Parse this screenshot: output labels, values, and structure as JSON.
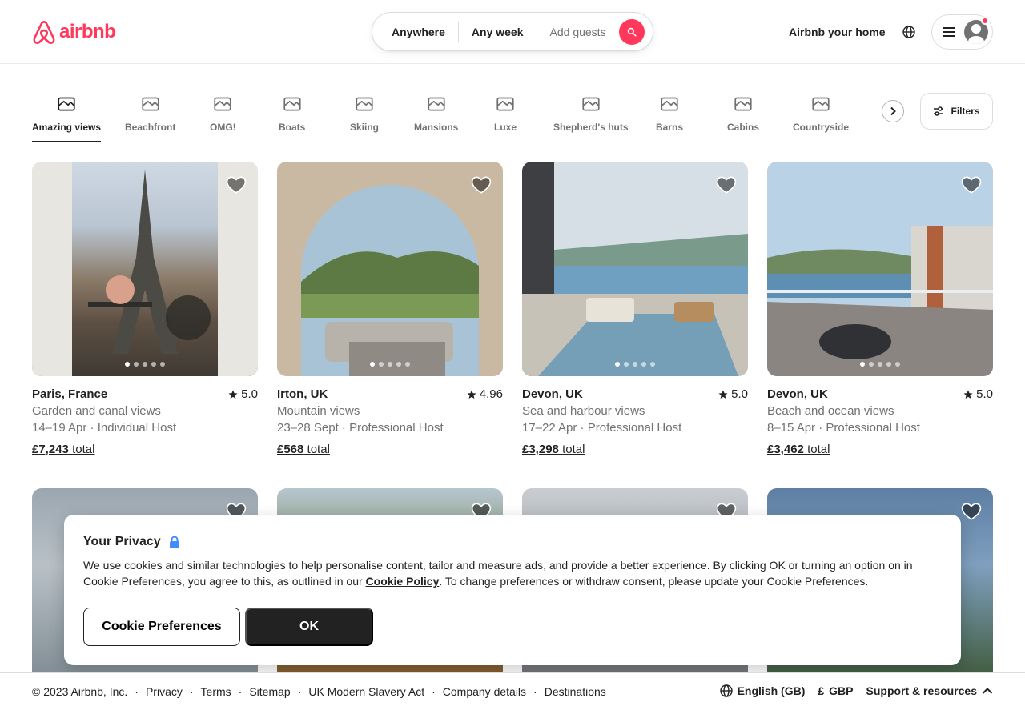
{
  "brand": {
    "name": "airbnb",
    "color": "#ff385c"
  },
  "search": {
    "where": "Anywhere",
    "when": "Any week",
    "who": "Add guests"
  },
  "header": {
    "host_link": "Airbnb your home"
  },
  "categories": [
    {
      "label": "Amazing views",
      "icon": "amazing-views-icon",
      "active": true
    },
    {
      "label": "Beachfront",
      "icon": "beachfront-icon"
    },
    {
      "label": "OMG!",
      "icon": "omg-icon"
    },
    {
      "label": "Boats",
      "icon": "boat-icon"
    },
    {
      "label": "Skiing",
      "icon": "skiing-icon"
    },
    {
      "label": "Mansions",
      "icon": "mansion-icon"
    },
    {
      "label": "Luxe",
      "icon": "luxe-icon"
    },
    {
      "label": "Shepherd's huts",
      "icon": "shepherds-hut-icon"
    },
    {
      "label": "Barns",
      "icon": "barn-icon"
    },
    {
      "label": "Cabins",
      "icon": "cabin-icon"
    },
    {
      "label": "Countryside",
      "icon": "countryside-icon"
    }
  ],
  "filters_label": "Filters",
  "listings": [
    {
      "title": "Paris, France",
      "rating": "5.0",
      "subtitle": "Garden and canal views",
      "dates": "14–19 Apr · Individual Host",
      "price": "£7,243",
      "price_suffix": "total"
    },
    {
      "title": "Irton, UK",
      "rating": "4.96",
      "subtitle": "Mountain views",
      "dates": "23–28 Sept · Professional Host",
      "price": "£568",
      "price_suffix": "total"
    },
    {
      "title": "Devon, UK",
      "rating": "5.0",
      "subtitle": "Sea and harbour views",
      "dates": "17–22 Apr · Professional Host",
      "price": "£3,298",
      "price_suffix": "total"
    },
    {
      "title": "Devon, UK",
      "rating": "5.0",
      "subtitle": "Beach and ocean views",
      "dates": "8–15 Apr · Professional Host",
      "price": "£3,462",
      "price_suffix": "total"
    }
  ],
  "cookie": {
    "title": "Your Privacy",
    "text_before": "We use cookies and similar technologies to help personalise content, tailor and measure ads, and provide a better experience. By clicking OK or turning an option on in Cookie Preferences, you agree to this, as outlined in our ",
    "policy_link": "Cookie Policy",
    "text_after": ". To change preferences or withdraw consent, please update your Cookie Preferences.",
    "preferences_button": "Cookie Preferences",
    "ok_button": "OK"
  },
  "footer": {
    "copyright": "© 2023 Airbnb, Inc.",
    "links": [
      "Privacy",
      "Terms",
      "Sitemap",
      "UK Modern Slavery Act",
      "Company details",
      "Destinations"
    ],
    "language": "English (GB)",
    "currency_symbol": "£",
    "currency": "GBP",
    "support": "Support & resources"
  }
}
